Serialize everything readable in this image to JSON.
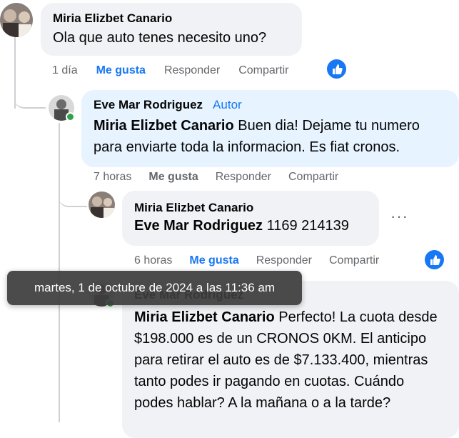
{
  "comments": [
    {
      "author": "Miria Elizbet Canario",
      "text": "Ola que auto tenes necesito uno?",
      "time": "1 día",
      "like": "Me gusta",
      "reply": "Responder",
      "share": "Compartir"
    },
    {
      "author": "Eve Mar Rodriguez",
      "author_tag": "Autor",
      "mention": "Miria Elizbet Canario",
      "text": " Buen dia! Dejame tu numero para enviarte toda la informacion. Es fiat cronos.",
      "time": "7 horas",
      "like": "Me gusta",
      "reply": "Responder",
      "share": "Compartir"
    },
    {
      "author": "Miria Elizbet Canario",
      "mention": "Eve Mar Rodriguez",
      "text": " 1169 214139",
      "time": "6 horas",
      "like": "Me gusta",
      "reply": "Responder",
      "share": "Compartir",
      "more": "···"
    },
    {
      "author": "Eve Mar Rodriguez",
      "mention": "Miria Elizbet Canario",
      "text": " Perfecto! La cuota desde $198.000 es de un CRONOS 0KM. El anticipo para retirar el auto es de $7.133.400, mientras tanto podes ir pagando en cuotas. Cuándo podes hablar? A la mañana o a la tarde?"
    }
  ],
  "tooltip": "martes, 1 de octubre de 2024 a las 11:36 am",
  "colors": {
    "accent": "#1877f2",
    "bubble": "#f0f2f5",
    "author_bubble": "#e7f3ff",
    "online": "#31a24c"
  },
  "icons": [
    "like-thumb-icon",
    "more-options-icon",
    "online-status-icon"
  ]
}
